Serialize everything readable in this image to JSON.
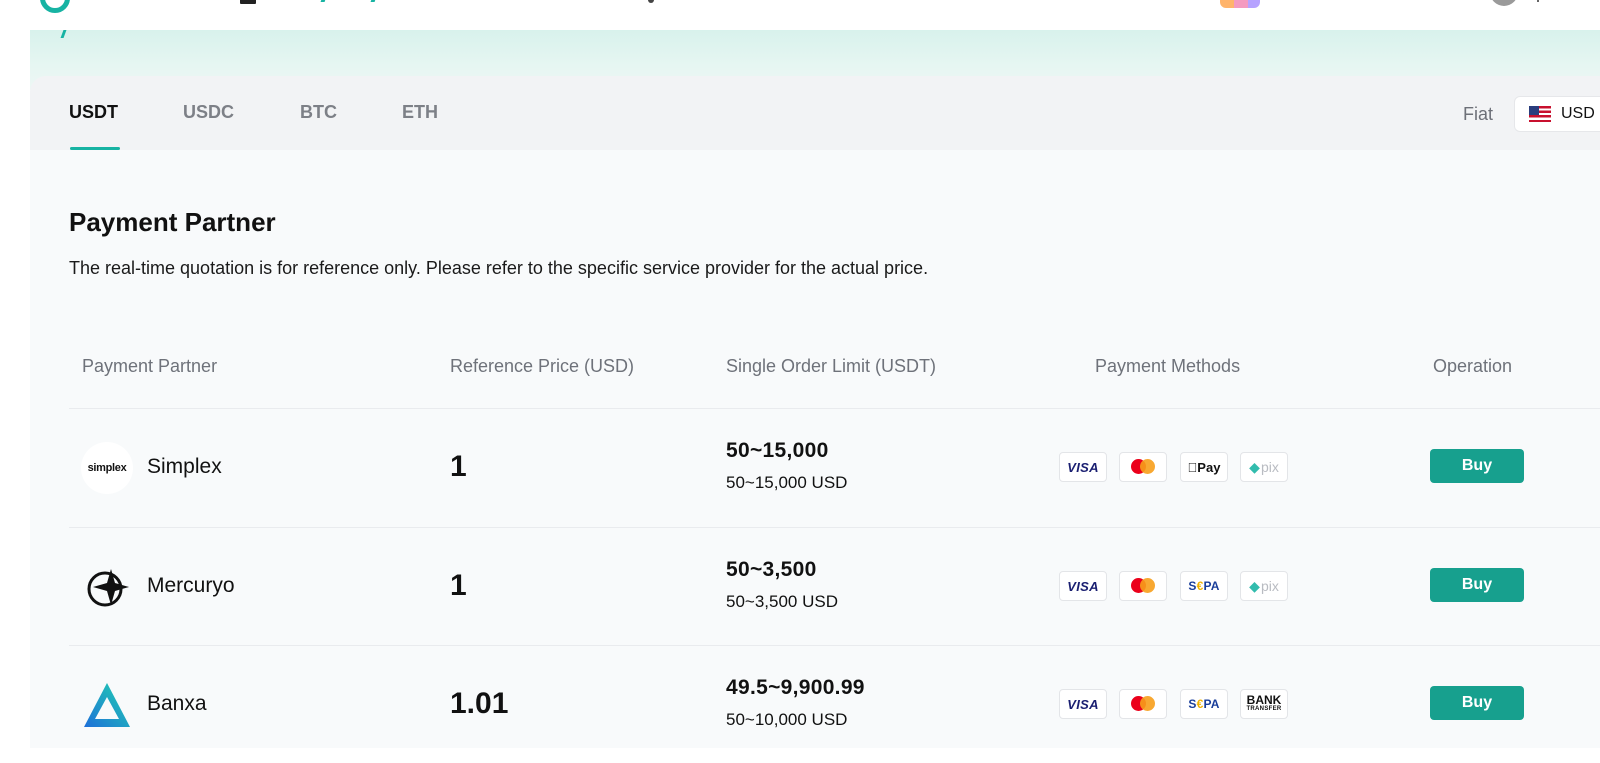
{
  "tabs": [
    {
      "label": "USDT",
      "active": true
    },
    {
      "label": "USDC",
      "active": false
    },
    {
      "label": "BTC",
      "active": false
    },
    {
      "label": "ETH",
      "active": false
    }
  ],
  "fiat": {
    "label": "Fiat",
    "selected": "USD",
    "flag_icon": "us-flag-icon"
  },
  "section": {
    "title": "Payment Partner",
    "description": "The real-time quotation is for reference only. Please refer to the specific service provider for the actual price."
  },
  "table": {
    "headers": [
      "Payment Partner",
      "Reference Price (USD)",
      "Single Order Limit (USDT)",
      "Payment Methods",
      "Operation"
    ],
    "rows": [
      {
        "partner": "Simplex",
        "logo_text": "simplex",
        "price": "1",
        "limit": "50~15,000",
        "limit_fiat": "50~15,000 USD",
        "methods": [
          "visa-icon",
          "mastercard-icon",
          "apple-pay-icon",
          "pix-icon"
        ],
        "button": "Buy"
      },
      {
        "partner": "Mercuryo",
        "price": "1",
        "limit": "50~3,500",
        "limit_fiat": "50~3,500 USD",
        "methods": [
          "visa-icon",
          "mastercard-icon",
          "sepa-icon",
          "pix-icon"
        ],
        "button": "Buy"
      },
      {
        "partner": "Banxa",
        "price": "1.01",
        "limit": "49.5~9,900.99",
        "limit_fiat": "50~10,000 USD",
        "methods": [
          "visa-icon",
          "mastercard-icon",
          "sepa-icon",
          "bank-transfer-icon"
        ],
        "button": "Buy"
      }
    ]
  },
  "method_labels": {
    "visa": "VISA",
    "apple_pay": "Pay",
    "pix": "pix",
    "sepa_s": "S",
    "sepa_e": "€",
    "sepa_pa": "PA",
    "bank": "BANK",
    "bank_sub": "TRANSFER"
  },
  "colors": {
    "accent": "#17b3a3",
    "buy_button": "#17a08e",
    "page_bg": "#f8fafb",
    "tabs_bg": "#f2f3f5"
  }
}
